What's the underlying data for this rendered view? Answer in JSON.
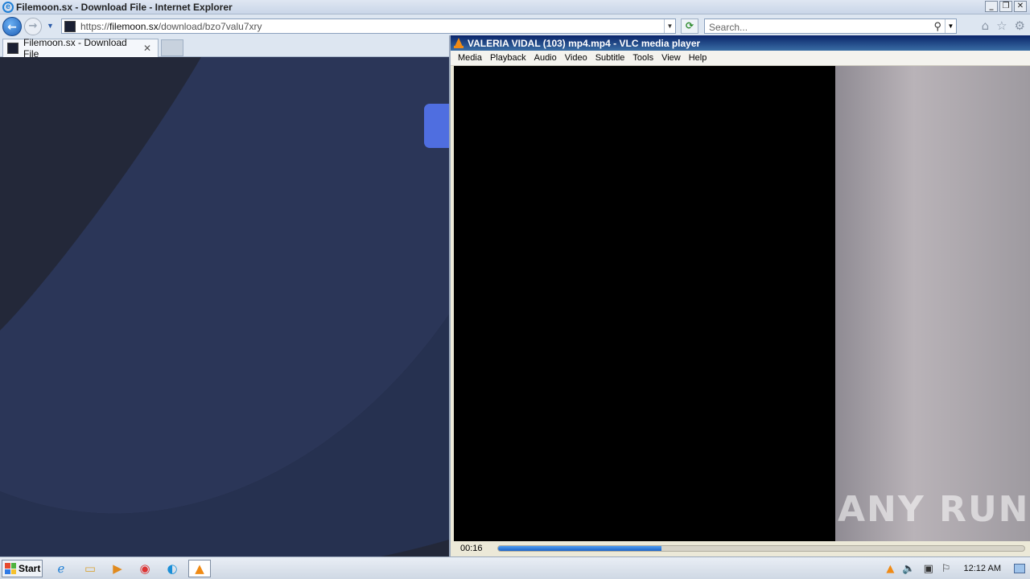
{
  "ie": {
    "window_title": "Filemoon.sx - Download File - Internet Explorer",
    "url_prefix": "https://",
    "url_host": "filemoon.sx",
    "url_path": "/download/bzo7valu7xry",
    "search_placeholder": "Search...",
    "tab_label": "Filemoon.sx - Download File"
  },
  "vlc": {
    "window_title": "VALERIA VIDAL (103) mp4.mp4 - VLC media player",
    "menu": [
      "Media",
      "Playback",
      "Audio",
      "Video",
      "Subtitle",
      "Tools",
      "View",
      "Help"
    ],
    "elapsed": "00:16",
    "progress_fraction": 0.31,
    "watermark": "ANY RUN"
  },
  "taskbar": {
    "start_label": "Start",
    "clock": "12:12 AM"
  },
  "colors": {
    "page_bg": "#232839",
    "page_wave": "#2b3658",
    "accent_button": "#4f6ee0",
    "vlc_progress": "#1c64c8"
  }
}
